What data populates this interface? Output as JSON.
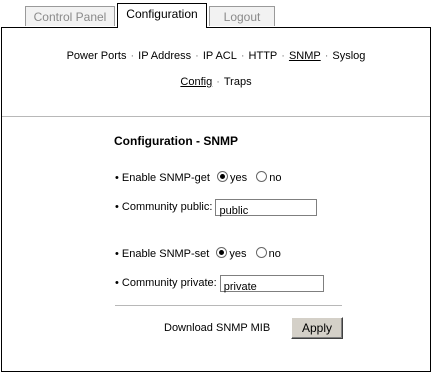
{
  "tabs": [
    {
      "label": "Control Panel",
      "active": false
    },
    {
      "label": "Configuration",
      "active": true
    },
    {
      "label": "Logout",
      "active": false
    }
  ],
  "nav_primary": [
    "Power Ports",
    "IP Address",
    "IP ACL",
    "HTTP",
    "SNMP",
    "Syslog"
  ],
  "nav_primary_selected": "SNMP",
  "nav_secondary": [
    "Config",
    "Traps"
  ],
  "nav_secondary_selected": "Config",
  "separator": "·",
  "form": {
    "title": "Configuration - SNMP",
    "bullet": "•",
    "snmp_get": {
      "label": "Enable SNMP-get",
      "yes": "yes",
      "no": "no",
      "selected": "yes"
    },
    "community_public": {
      "label": "Community public:",
      "value": "public"
    },
    "snmp_set": {
      "label": "Enable SNMP-set",
      "yes": "yes",
      "no": "no",
      "selected": "yes"
    },
    "community_private": {
      "label": "Community private:",
      "value": "private"
    },
    "download_link": "Download SNMP MIB",
    "apply_label": "Apply"
  }
}
